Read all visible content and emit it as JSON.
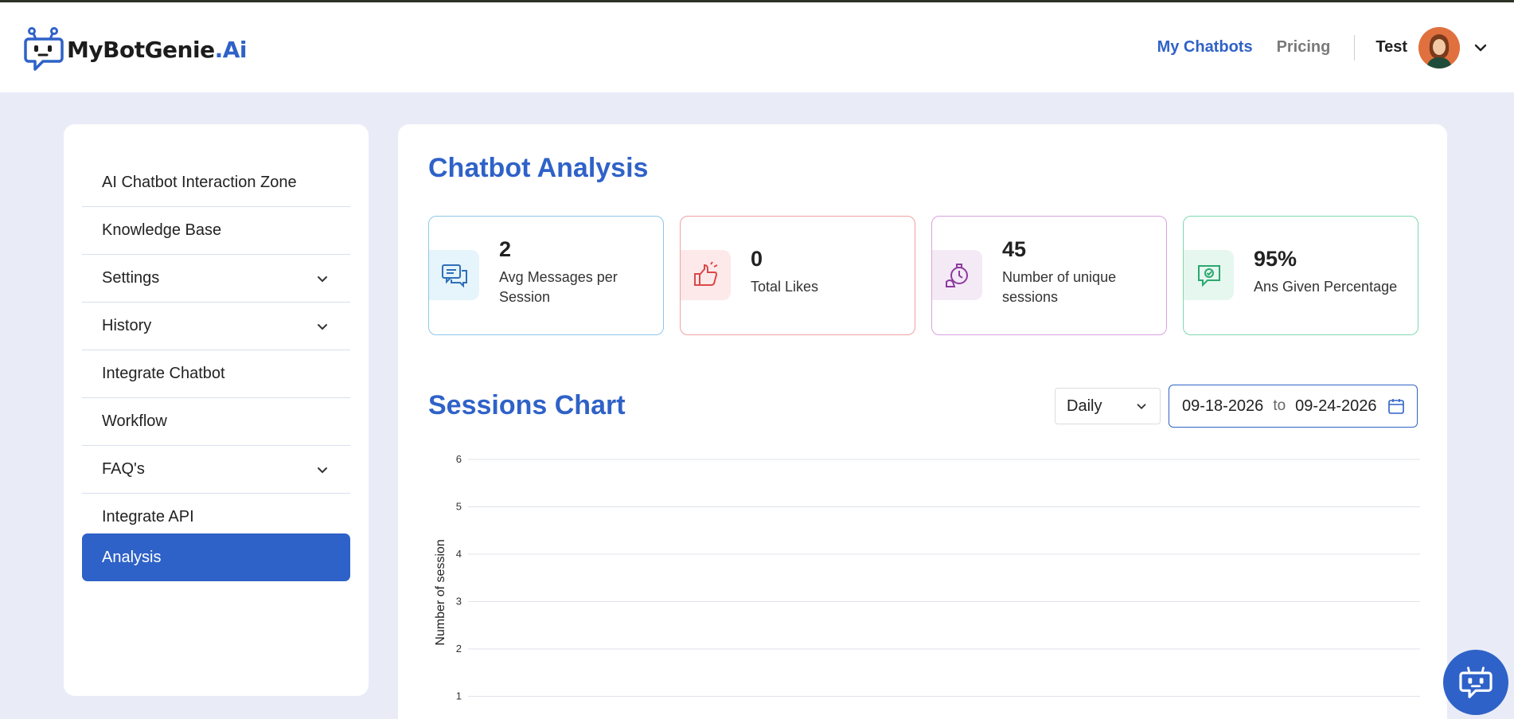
{
  "brand": {
    "name_main": "MyBotGenie",
    "name_suffix": ".Ai",
    "logo_icon": "robot-chat-icon"
  },
  "nav": {
    "my_chatbots": "My Chatbots",
    "pricing": "Pricing",
    "user_name": "Test",
    "avatar_icon": "user-avatar",
    "chevron_icon": "chevron-down-icon"
  },
  "sidebar": {
    "items": [
      {
        "label": "AI Chatbot Interaction Zone",
        "has_chevron": false
      },
      {
        "label": "Knowledge Base",
        "has_chevron": false
      },
      {
        "label": "Settings",
        "has_chevron": true
      },
      {
        "label": "History",
        "has_chevron": true
      },
      {
        "label": "Integrate Chatbot",
        "has_chevron": false
      },
      {
        "label": "Workflow",
        "has_chevron": false
      },
      {
        "label": "FAQ's",
        "has_chevron": true
      },
      {
        "label": "Integrate API",
        "has_chevron": false
      },
      {
        "label": "Analysis",
        "has_chevron": false,
        "active": true
      }
    ]
  },
  "main": {
    "title": "Chatbot Analysis",
    "cards": [
      {
        "value": "2",
        "label": "Avg Messages per Session",
        "icon": "chat-bubbles-icon",
        "color": "#4aa3df",
        "bg": "#e6f4fb"
      },
      {
        "value": "0",
        "label": "Total Likes",
        "icon": "thumbs-up-icon",
        "color": "#e26a6a",
        "bg": "#fde9ea"
      },
      {
        "value": "45",
        "label": "Number of unique sessions",
        "icon": "session-timer-icon",
        "color": "#b34fc0",
        "bg": "#f4eaf6"
      },
      {
        "value": "95%",
        "label": "Ans Given Percentage",
        "icon": "check-message-icon",
        "color": "#2ebf7e",
        "bg": "#e6f7ef"
      }
    ],
    "sessions_title": "Sessions Chart",
    "period_select": "Daily",
    "date_from": "09-18-2026",
    "date_to_word": "to",
    "date_to": "09-24-2026",
    "calendar_icon": "calendar-icon"
  },
  "chart_data": {
    "type": "line",
    "ylabel": "Number of session",
    "yticks": [
      "6",
      "5",
      "4",
      "3",
      "2",
      "1"
    ],
    "ylim": [
      0,
      6
    ],
    "grid": true
  },
  "fab": {
    "icon": "chatbot-icon"
  }
}
